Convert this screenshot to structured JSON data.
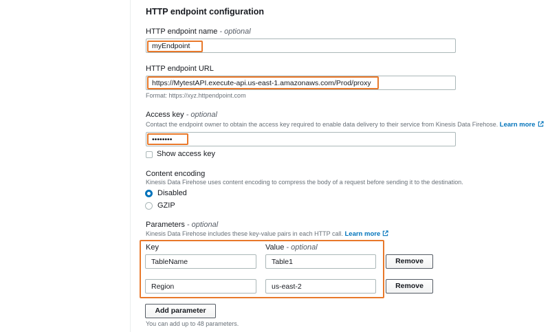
{
  "section": {
    "title": "HTTP endpoint configuration"
  },
  "endpoint_name": {
    "label": "HTTP endpoint name",
    "optional": "- optional",
    "value": "myEndpoint"
  },
  "endpoint_url": {
    "label": "HTTP endpoint URL",
    "value": "https://MytestAPI.execute-api.us-east-1.amazonaws.com/Prod/proxy",
    "format_hint": "Format: https://xyz.httpendpoint.com"
  },
  "access_key": {
    "label": "Access key",
    "optional": "- optional",
    "description": "Contact the endpoint owner to obtain the access key required to enable data delivery to their service from Kinesis Data Firehose.",
    "learn_more": "Learn more",
    "value": "••••••••",
    "show_label": "Show access key"
  },
  "content_encoding": {
    "label": "Content encoding",
    "description": "Kinesis Data Firehose uses content encoding to compress the body of a request before sending it to the destination.",
    "options": [
      "Disabled",
      "GZIP"
    ],
    "selected": "Disabled"
  },
  "parameters": {
    "label": "Parameters",
    "optional": "- optional",
    "description": "Kinesis Data Firehose includes these key-value pairs in each HTTP call.",
    "learn_more": "Learn more",
    "key_header": "Key",
    "value_header": "Value",
    "value_optional": "- optional",
    "rows": [
      {
        "key": "TableName",
        "value": "Table1",
        "remove": "Remove"
      },
      {
        "key": "Region",
        "value": "us-east-2",
        "remove": "Remove"
      }
    ],
    "add_button": "Add parameter",
    "limit_note": "You can add up to 48 parameters."
  },
  "colors": {
    "highlight": "#e8782a",
    "link": "#0073bb",
    "radio_selected": "#0073bb"
  },
  "icons": {
    "external_link": "external-link-icon"
  }
}
